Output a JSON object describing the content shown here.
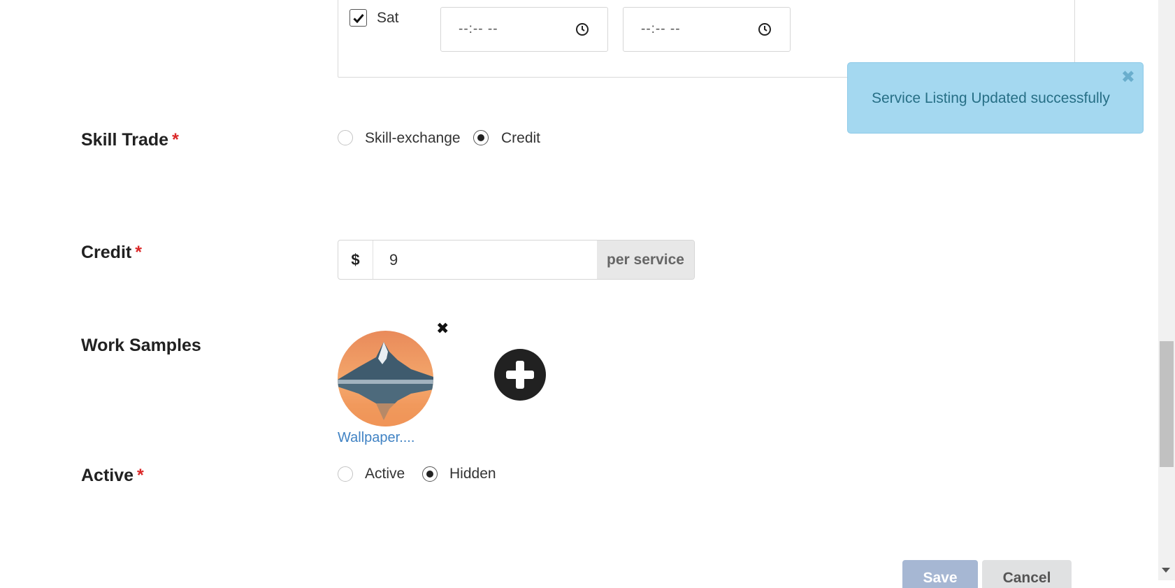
{
  "schedule": {
    "day_label": "Sat",
    "day_checked": true,
    "start_time_placeholder": "--:-- --",
    "end_time_placeholder": "--:-- --"
  },
  "skill_trade": {
    "label": "Skill Trade",
    "required_marker": "*",
    "options": [
      "Skill-exchange",
      "Credit"
    ],
    "selected": "Credit"
  },
  "credit": {
    "label": "Credit",
    "required_marker": "*",
    "prefix": "$",
    "value": "9",
    "suffix": "per service"
  },
  "work_samples": {
    "label": "Work Samples",
    "file_name": "Wallpaper....",
    "remove_glyph": "✖",
    "add_icon": "plus-circle-icon"
  },
  "active": {
    "label": "Active",
    "required_marker": "*",
    "options": [
      "Active",
      "Hidden"
    ],
    "selected": "Hidden"
  },
  "toast": {
    "message": "Service Listing Updated successfully",
    "close_glyph": "✖",
    "color": "#a4d8f0"
  },
  "actions": {
    "save_label": "Save",
    "cancel_label": "Cancel"
  },
  "colors": {
    "required": "#db2828",
    "link": "#4183c4",
    "save_button": "#a6b7d3"
  }
}
